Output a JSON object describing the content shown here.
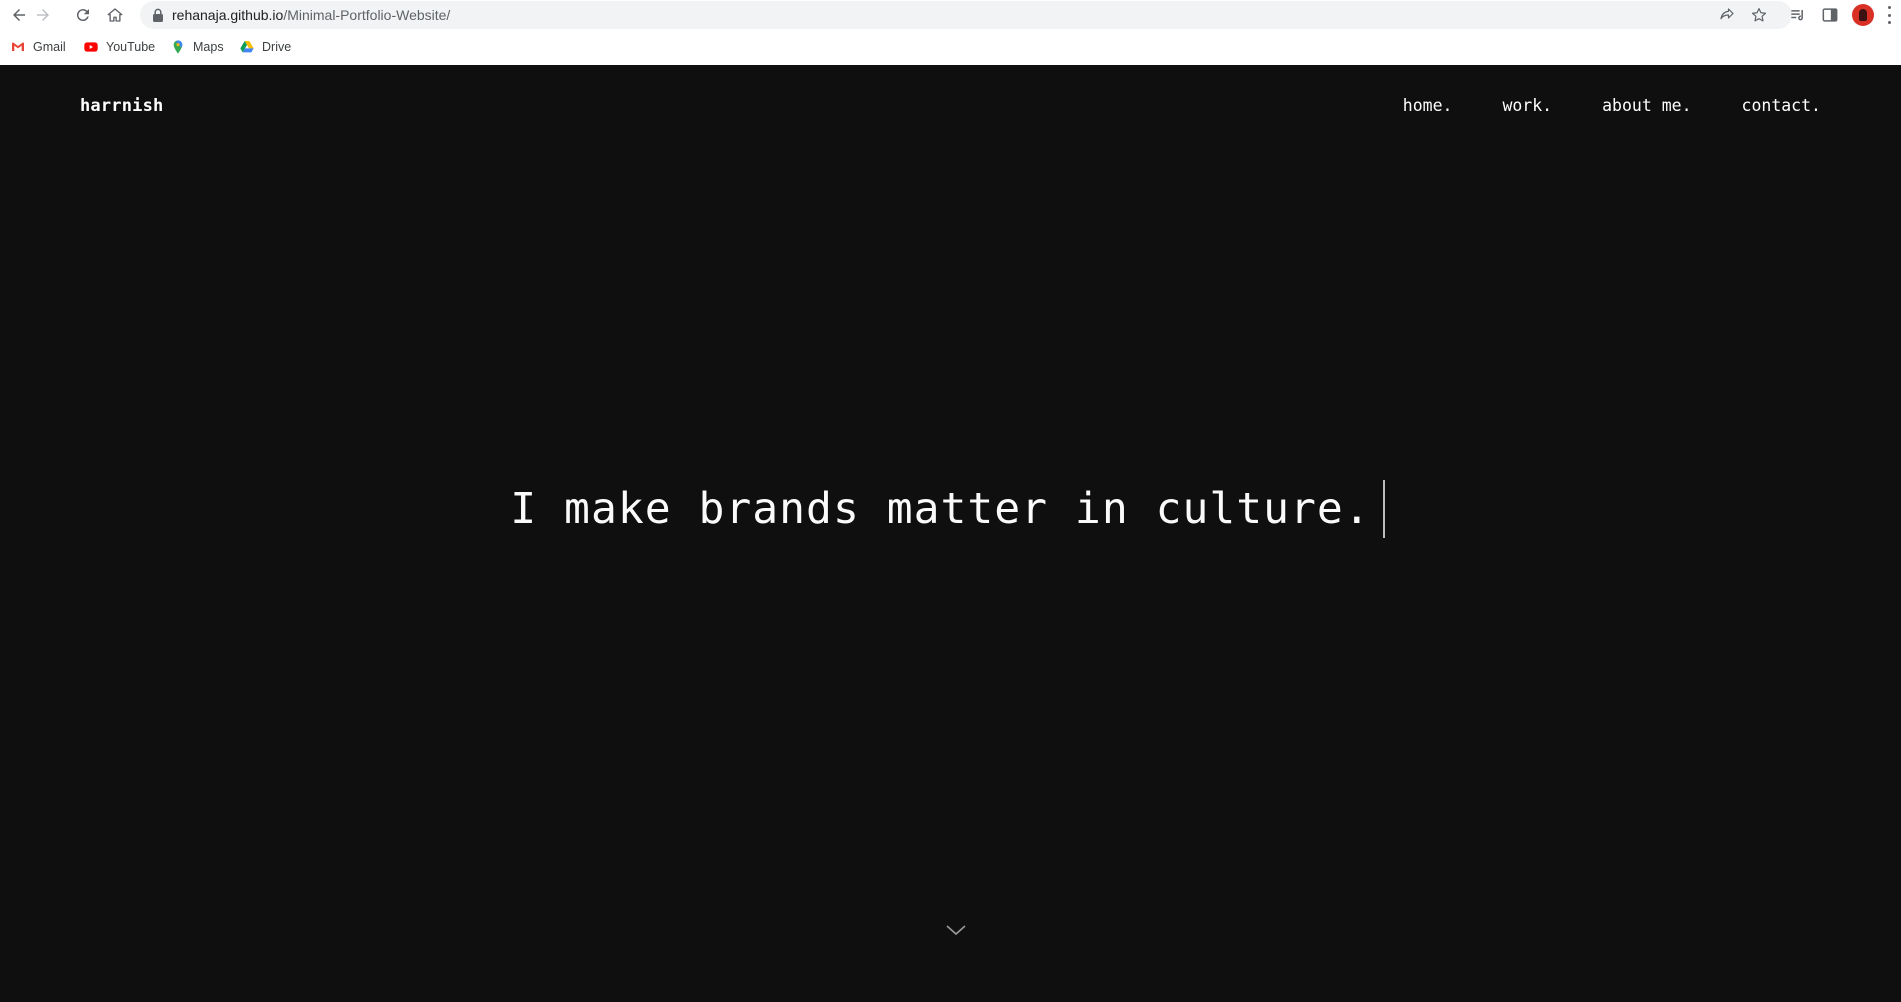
{
  "browser": {
    "url_host": "rehanaja.github.io",
    "url_path": "/Minimal-Portfolio-Website/",
    "bookmarks": [
      {
        "label": "Gmail",
        "icon": "gmail-icon"
      },
      {
        "label": "YouTube",
        "icon": "youtube-icon"
      },
      {
        "label": "Maps",
        "icon": "maps-icon"
      },
      {
        "label": "Drive",
        "icon": "drive-icon"
      }
    ]
  },
  "site": {
    "brand": "harrnish",
    "nav": [
      "home.",
      "work.",
      "about me.",
      "contact."
    ],
    "hero_text": "I make brands matter in culture.",
    "scroll_icon": "chevron-down-icon"
  },
  "colors": {
    "page_background": "#0f0f0f",
    "text": "#ffffff",
    "browser_bar": "#f1f3f4"
  }
}
